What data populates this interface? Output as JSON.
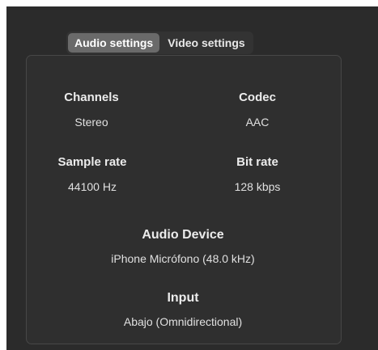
{
  "tabs": [
    {
      "label": "Audio settings",
      "active": true
    },
    {
      "label": "Video settings",
      "active": false
    }
  ],
  "fields": {
    "channels": {
      "label": "Channels",
      "value": "Stereo"
    },
    "codec": {
      "label": "Codec",
      "value": "AAC"
    },
    "sample_rate": {
      "label": "Sample rate",
      "value": "44100 Hz"
    },
    "bit_rate": {
      "label": "Bit rate",
      "value": "128 kbps"
    },
    "audio_device": {
      "label": "Audio Device",
      "value": "iPhone Micrófono (48.0 kHz)"
    },
    "input": {
      "label": "Input",
      "value": "Abajo (Omnidirectional)"
    }
  },
  "colors": {
    "window_background": "#2b2b2b",
    "active_tab": "#6a6a6a",
    "text": "#ececec"
  }
}
